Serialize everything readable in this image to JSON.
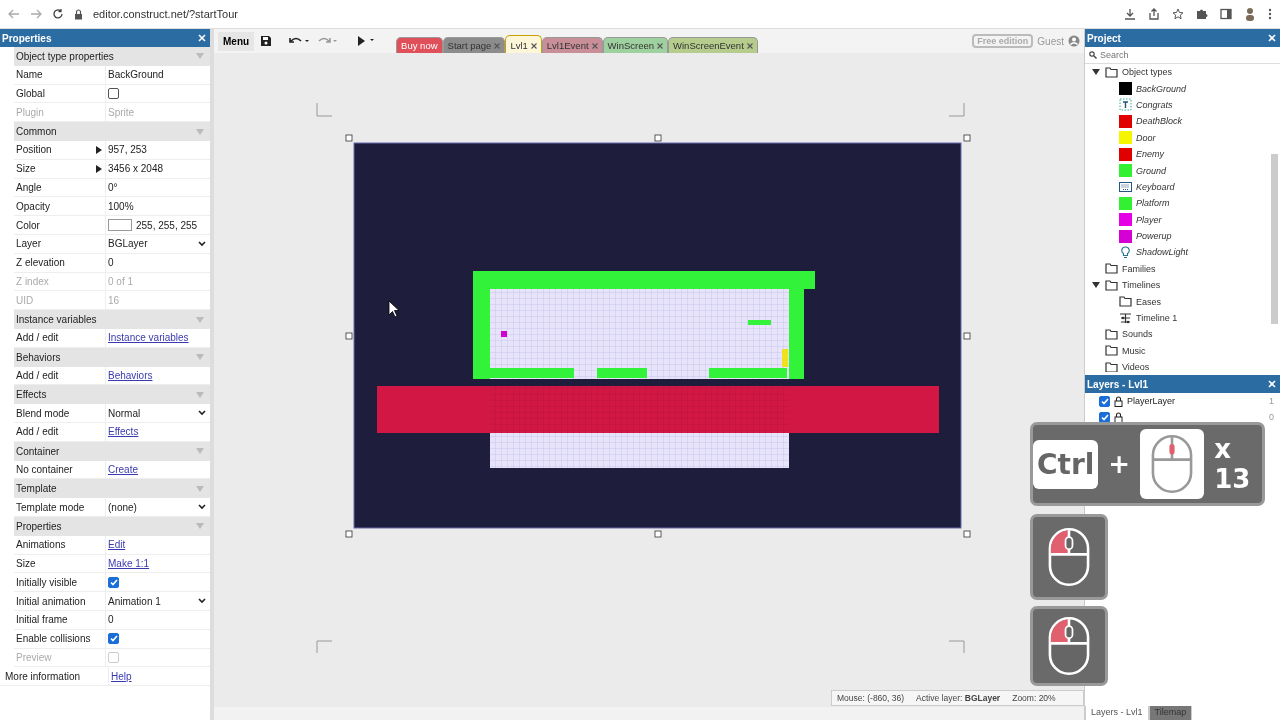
{
  "browser": {
    "url": "editor.construct.net/?startTour"
  },
  "properties_panel": {
    "title": "Properties",
    "rows": [
      {
        "kind": "section",
        "label": "Object type properties",
        "disabled": false
      },
      {
        "kind": "text",
        "label": "Name",
        "value": "BackGround",
        "disabled": false
      },
      {
        "kind": "checkbox",
        "label": "Global",
        "checked": false,
        "disabled": false
      },
      {
        "kind": "text",
        "label": "Plugin",
        "value": "Sprite",
        "disabled": true
      },
      {
        "kind": "section",
        "label": "Common",
        "disabled": false
      },
      {
        "kind": "expand",
        "label": "Position",
        "value": "957, 253",
        "disabled": false
      },
      {
        "kind": "expand",
        "label": "Size",
        "value": "3456 x 2048",
        "disabled": false
      },
      {
        "kind": "text",
        "label": "Angle",
        "value": "0°",
        "disabled": false
      },
      {
        "kind": "text",
        "label": "Opacity",
        "value": "100%",
        "disabled": false
      },
      {
        "kind": "color",
        "label": "Color",
        "value": "255, 255, 255",
        "color": "#ffffff",
        "disabled": false
      },
      {
        "kind": "select",
        "label": "Layer",
        "value": "BGLayer",
        "disabled": false
      },
      {
        "kind": "text",
        "label": "Z elevation",
        "value": "0",
        "disabled": false
      },
      {
        "kind": "text",
        "label": "Z index",
        "value": "0 of 1",
        "disabled": true
      },
      {
        "kind": "text",
        "label": "UID",
        "value": "16",
        "disabled": true
      },
      {
        "kind": "section",
        "label": "Instance variables",
        "disabled": false
      },
      {
        "kind": "link",
        "label": "Add / edit",
        "value": "Instance variables",
        "disabled": false
      },
      {
        "kind": "section",
        "label": "Behaviors",
        "disabled": false
      },
      {
        "kind": "link",
        "label": "Add / edit",
        "value": "Behaviors",
        "disabled": false
      },
      {
        "kind": "section",
        "label": "Effects",
        "disabled": false
      },
      {
        "kind": "select",
        "label": "Blend mode",
        "value": "Normal",
        "disabled": false
      },
      {
        "kind": "link",
        "label": "Add / edit",
        "value": "Effects",
        "disabled": false
      },
      {
        "kind": "section",
        "label": "Container",
        "disabled": false
      },
      {
        "kind": "link",
        "label": "No container",
        "value": "Create",
        "disabled": false
      },
      {
        "kind": "section",
        "label": "Template",
        "disabled": false
      },
      {
        "kind": "select",
        "label": "Template mode",
        "value": "(none)",
        "disabled": false
      },
      {
        "kind": "section",
        "label": "Properties",
        "disabled": false
      },
      {
        "kind": "link",
        "label": "Animations",
        "value": "Edit",
        "disabled": false
      },
      {
        "kind": "link",
        "label": "Size",
        "value": "Make 1:1",
        "disabled": false
      },
      {
        "kind": "checkbox",
        "label": "Initially visible",
        "checked": true,
        "disabled": false
      },
      {
        "kind": "select",
        "label": "Initial animation",
        "value": "Animation 1",
        "disabled": false
      },
      {
        "kind": "text",
        "label": "Initial frame",
        "value": "0",
        "disabled": false
      },
      {
        "kind": "checkbox",
        "label": "Enable collisions",
        "checked": true,
        "disabled": false
      },
      {
        "kind": "checkbox",
        "label": "Preview",
        "checked": false,
        "disabled": true
      },
      {
        "kind": "info",
        "label": "More information",
        "value": "Help",
        "disabled": false
      }
    ]
  },
  "toolbar": {
    "menu": "Menu",
    "tabs": [
      {
        "label": "Buy now",
        "color": "#e0505a",
        "closable": false,
        "selected": false
      },
      {
        "label": "Start page",
        "color": "#8c8c8c",
        "closable": true,
        "selected": false
      },
      {
        "label": "Lvl1",
        "color": "#fdf6d8",
        "closable": true,
        "selected": true
      },
      {
        "label": "Lvl1Event",
        "color": "#c98f98",
        "closable": true,
        "selected": false
      },
      {
        "label": "WinScreen",
        "color": "#9fd09f",
        "closable": true,
        "selected": false
      },
      {
        "label": "WinScreenEvent",
        "color": "#b5cc8c",
        "closable": true,
        "selected": false
      }
    ],
    "edition": "Free edition",
    "user": "Guest"
  },
  "status_bar": {
    "mouse": "Mouse: (-860, 36)",
    "active_layer": "Active layer: **BGLayer**",
    "zoom": "Zoom: 20%"
  },
  "project_panel": {
    "title": "Project",
    "search_placeholder": "Search",
    "tree": [
      {
        "kind": "folder",
        "label": "Object types",
        "expanded": true,
        "children": [
          {
            "kind": "swatch",
            "label": "BackGround",
            "color": "#000000"
          },
          {
            "kind": "text",
            "label": "Congrats"
          },
          {
            "kind": "swatch",
            "label": "DeathBlock",
            "color": "#e00000"
          },
          {
            "kind": "swatch",
            "label": "Door",
            "color": "#f5f500"
          },
          {
            "kind": "swatch",
            "label": "Enemy",
            "color": "#e00000"
          },
          {
            "kind": "swatch",
            "label": "Ground",
            "color": "#33f033"
          },
          {
            "kind": "keyboard",
            "label": "Keyboard"
          },
          {
            "kind": "swatch",
            "label": "Platform",
            "color": "#33f033"
          },
          {
            "kind": "swatch",
            "label": "Player",
            "color": "#e600e6"
          },
          {
            "kind": "swatch",
            "label": "Powerup",
            "color": "#d400d4"
          },
          {
            "kind": "light",
            "label": "ShadowLight"
          }
        ]
      },
      {
        "kind": "folder",
        "label": "Families",
        "expanded": false
      },
      {
        "kind": "folder",
        "label": "Timelines",
        "expanded": true,
        "children": [
          {
            "kind": "folder",
            "label": "Eases",
            "expanded": false
          },
          {
            "kind": "timeline",
            "label": "Timeline 1"
          }
        ]
      },
      {
        "kind": "folder",
        "label": "Sounds",
        "expanded": false
      },
      {
        "kind": "folder",
        "label": "Music",
        "expanded": false
      },
      {
        "kind": "folder",
        "label": "Videos",
        "expanded": false
      }
    ]
  },
  "layers_panel": {
    "title": "Layers - Lvl1",
    "rows": [
      {
        "name": "PlayerLayer",
        "visible": true,
        "number": "1"
      },
      {
        "visible": true,
        "number": "0"
      }
    ]
  },
  "bottom_tabs": [
    {
      "label": "Layers - Lvl1",
      "selected": true
    },
    {
      "label": "Tilemap",
      "selected": false
    }
  ],
  "overlay": {
    "key": "Ctrl",
    "plus": "+",
    "count": "x 13"
  }
}
